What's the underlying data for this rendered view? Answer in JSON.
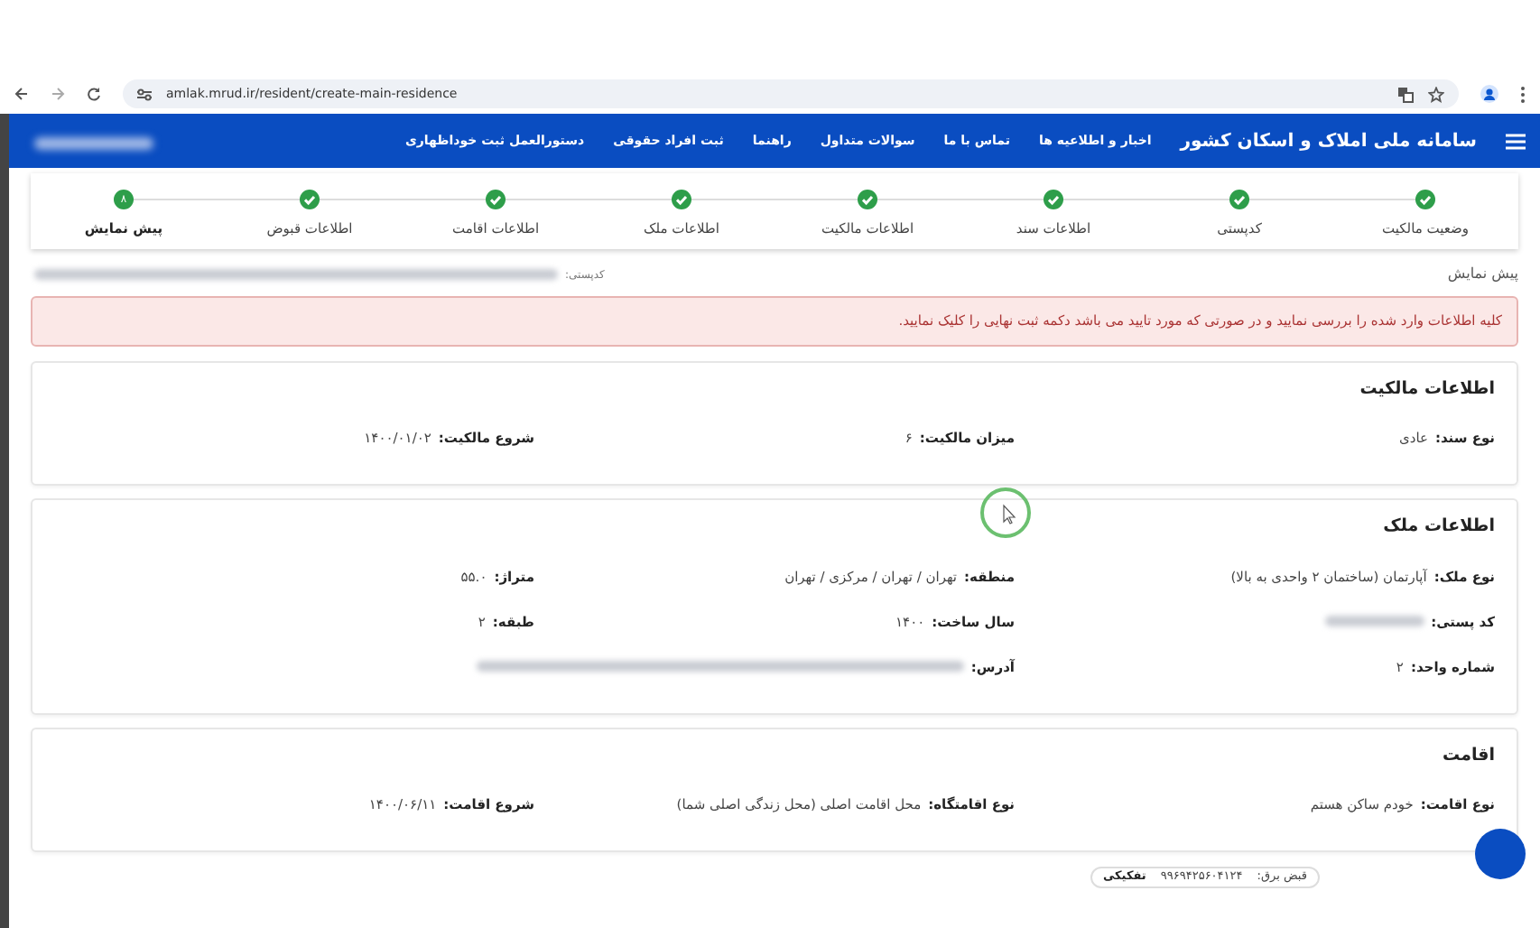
{
  "browser": {
    "url": "amlak.mrud.ir/resident/create-main-residence"
  },
  "navbar": {
    "title": "سامانه ملی املاک و اسکان کشور",
    "user_blurred": true,
    "links": [
      "اخبار و اطلاعیه ها",
      "تماس با ما",
      "سوالات متداول",
      "راهنما",
      "ثبت افراد حقوقی",
      "دستورالعمل ثبت خوداظهاری"
    ]
  },
  "steps": [
    {
      "label": "وضعیت مالکیت",
      "completed": true,
      "selected": false
    },
    {
      "label": "کدپستی",
      "completed": true,
      "selected": false
    },
    {
      "label": "اطلاعات سند",
      "completed": true,
      "selected": false
    },
    {
      "label": "اطلاعات مالکیت",
      "completed": true,
      "selected": false
    },
    {
      "label": "اطلاعات ملک",
      "completed": true,
      "selected": false
    },
    {
      "label": "اطلاعات اقامت",
      "completed": true,
      "selected": false
    },
    {
      "label": "اطلاعات قبوض",
      "completed": true,
      "selected": false
    },
    {
      "label": "پیش نمایش",
      "completed": false,
      "selected": true,
      "number": "۸"
    }
  ],
  "breadcrumb": {
    "title": "پیش نمایش",
    "postcode_label": "کدپستی:",
    "postcode_blurred": true
  },
  "alert": "کلیه اطلاعات وارد شده را بررسی نمایید و در صورتی که مورد تایید می باشد دکمه ثبت نهایی را کلیک نمایید.",
  "sections": [
    {
      "title": "اطلاعات مالکیت",
      "rows": [
        [
          {
            "label": "نوع سند:",
            "value": "عادی"
          },
          {
            "label": "میزان مالکیت:",
            "value": "۶"
          },
          {
            "label": "شروع مالکیت:",
            "value": "۱۴۰۰/۰۱/۰۲"
          }
        ]
      ]
    },
    {
      "title": "اطلاعات ملک",
      "rows": [
        [
          {
            "label": "نوع ملک:",
            "value": "آپارتمان (ساختمان ۲ واحدی به بالا)"
          },
          {
            "label": "منطقه:",
            "value": "تهران / تهران / مرکزی / تهران"
          },
          {
            "label": "متراژ:",
            "value": "۵۵.۰"
          }
        ],
        [
          {
            "label": "کد پستی:",
            "blurred": true
          },
          {
            "label": "سال ساخت:",
            "value": "۱۴۰۰"
          },
          {
            "label": "طبقه:",
            "value": "۲"
          }
        ],
        [
          {
            "label": "شماره واحد:",
            "value": "۲"
          },
          {
            "label": "آدرس:",
            "blurred": true
          }
        ]
      ]
    },
    {
      "title": "اقامت",
      "rows": [
        [
          {
            "label": "نوع اقامت:",
            "value": "خودم ساکن هستم"
          },
          {
            "label": "نوع اقامتگاه:",
            "value": "محل اقامت اصلی (محل زندگی اصلی شما)"
          },
          {
            "label": "شروع اقامت:",
            "value": "۱۴۰۰/۰۶/۱۱"
          }
        ]
      ]
    }
  ],
  "bill": {
    "label": "قبض برق:",
    "value": "۹۹۶۹۴۲۵۶۰۴۱۲۴",
    "tag": "تفکیکی"
  }
}
